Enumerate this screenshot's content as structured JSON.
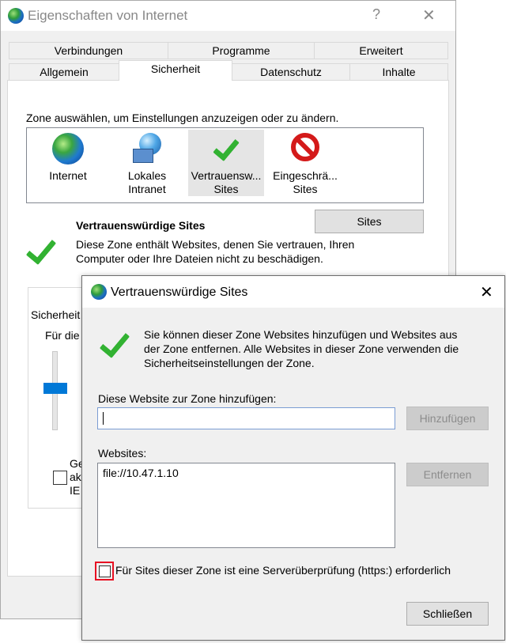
{
  "outer_window": {
    "title": "Eigenschaften von Internet",
    "help_label": "?",
    "close_label": "✕",
    "tabs_row1": [
      "Verbindungen",
      "Programme",
      "Erweitert"
    ],
    "tabs_row2": [
      "Allgemein",
      "Sicherheit",
      "Datenschutz",
      "Inhalte"
    ],
    "active_tab": "Sicherheit",
    "zone_prompt": "Zone auswählen, um Einstellungen anzuzeigen oder zu ändern.",
    "zones": [
      {
        "line1": "Internet",
        "line2": "",
        "icon": "globe-icon"
      },
      {
        "line1": "Lokales",
        "line2": "Intranet",
        "icon": "intranet-globe-icon"
      },
      {
        "line1": "Vertrauensw...",
        "line2": "Sites",
        "icon": "checkmark-icon"
      },
      {
        "line1": "Eingeschrä...",
        "line2": "Sites",
        "icon": "prohibited-icon"
      }
    ],
    "selected_zone_title": "Vertrauenswürdige Sites",
    "selected_zone_desc_line1": "Diese Zone enthält Websites, denen Sie vertrauen, Ihren",
    "selected_zone_desc_line2": "Computer oder Ihre Dateien nicht zu beschädigen.",
    "sites_button": "Sites",
    "security_level_label_partial": "Sicherheit",
    "for_zone_partial": "Für die",
    "protected_mode_partial": [
      "Ge",
      "ak",
      "IE"
    ]
  },
  "dialog": {
    "title": "Vertrauenswürdige Sites",
    "close_label": "✕",
    "info_line1": "Sie können dieser Zone Websites hinzufügen und Websites aus",
    "info_line2": "der Zone entfernen. Alle Websites in dieser Zone verwenden die",
    "info_line3": "Sicherheitseinstellungen der Zone.",
    "add_label": "Diese Website zur Zone hinzufügen:",
    "add_input_value": "",
    "add_button": "Hinzufügen",
    "websites_label": "Websites:",
    "websites": [
      "file://10.47.1.10"
    ],
    "remove_button": "Entfernen",
    "https_checkbox_label": "Für Sites dieser Zone ist eine Serverüberprüfung (https:) erforderlich",
    "https_checked": false,
    "close_button": "Schließen",
    "highlight_color": "#e81123"
  }
}
